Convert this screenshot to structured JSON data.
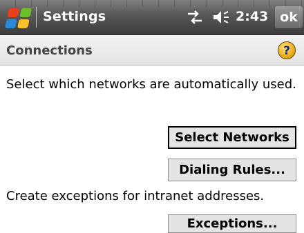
{
  "titlebar": {
    "title": "Settings",
    "clock": "2:43",
    "ok_label": "ok",
    "icons": [
      "start-flag-icon",
      "connectivity-icon",
      "volume-icon"
    ]
  },
  "page": {
    "title": "Connections",
    "help_icon": "help-question-icon"
  },
  "content": {
    "networks_text": "Select which networks are automatically used.",
    "select_networks_label": "Select Networks",
    "dialing_rules_label": "Dialing Rules...",
    "exceptions_text": "Create exceptions for intranet addresses.",
    "exceptions_label": "Exceptions..."
  },
  "colors": {
    "titlebar": "#4a4a4a",
    "help_icon": "#f0b000",
    "button_face": "#e4e4e4"
  }
}
